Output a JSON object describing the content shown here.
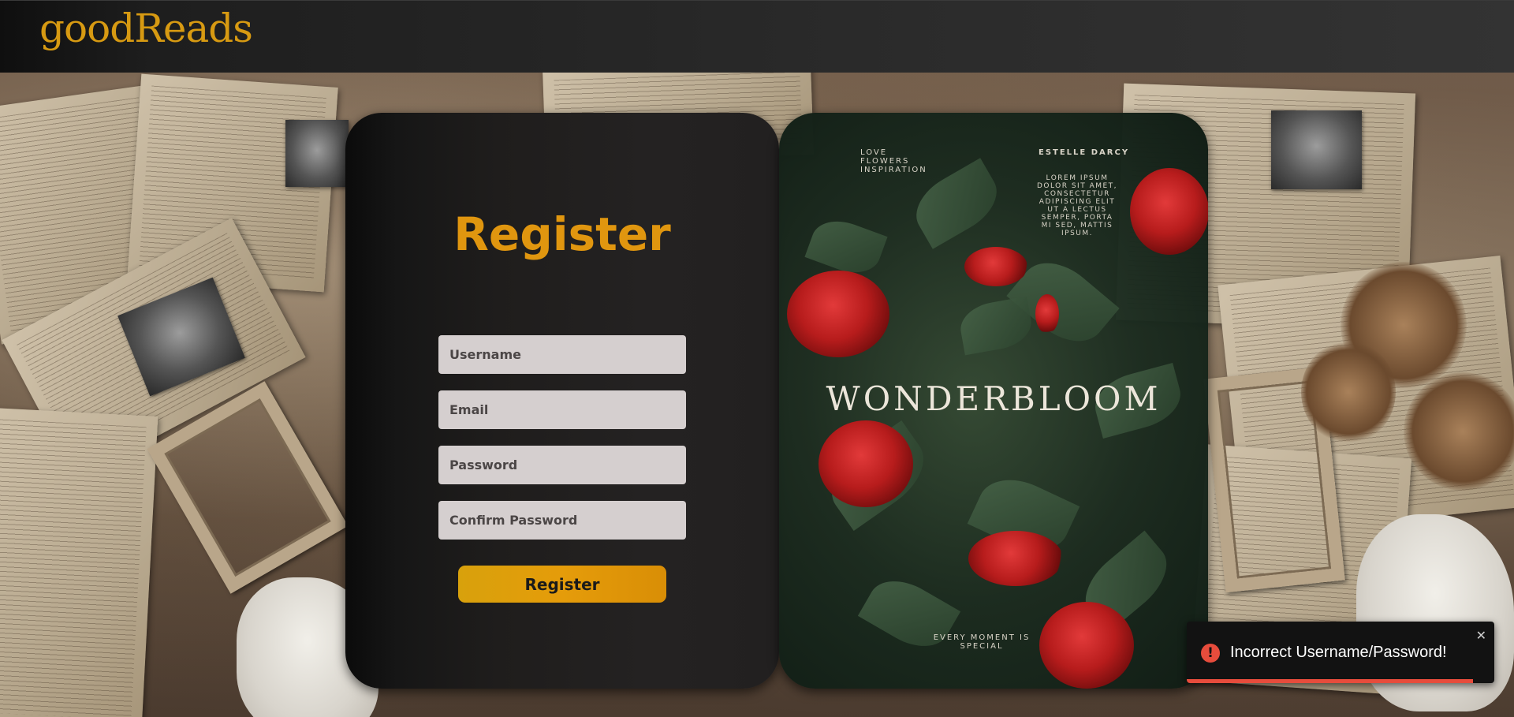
{
  "header": {
    "logo": "goodReads"
  },
  "form": {
    "title": "Register",
    "username_placeholder": "Username",
    "email_placeholder": "Email",
    "password_placeholder": "Password",
    "confirm_password_placeholder": "Confirm Password",
    "submit_label": "Register"
  },
  "book_cover": {
    "tagline_left": [
      "LOVE",
      "FLOWERS",
      "INSPIRATION"
    ],
    "author": "ESTELLE DARCY",
    "blurb": [
      "LOREM IPSUM",
      "DOLOR SIT AMET,",
      "CONSECTETUR",
      "ADIPISCING ELIT",
      "UT A LECTUS",
      "SEMPER, PORTA",
      "MI SED, MATTIS",
      "IPSUM."
    ],
    "title": "WONDERBLOOM",
    "footer": [
      "EVERY MOMENT IS",
      "SPECIAL"
    ]
  },
  "toast": {
    "icon": "error-icon",
    "message": "Incorrect Username/Password!",
    "close_icon": "close-icon",
    "accent_color": "#e74c3c",
    "progress": 0.93
  },
  "colors": {
    "brand": "#d79a12",
    "button": "#e09d0a"
  }
}
